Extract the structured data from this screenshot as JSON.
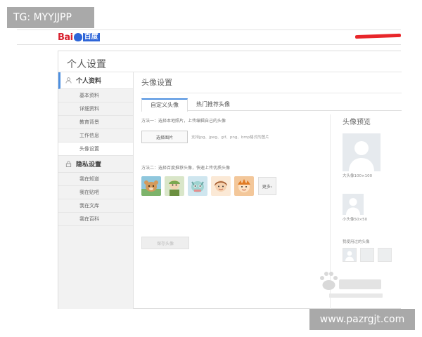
{
  "overlay": {
    "tg_label": "TG: MYYJJPP",
    "site_label": "www.pazrgjt.com"
  },
  "header": {
    "logo_left": "Bai",
    "logo_right": "百度"
  },
  "page": {
    "title": "个人设置"
  },
  "sidebar": {
    "section1": "个人资料",
    "items1": [
      "基本资料",
      "详细资料",
      "教育背景",
      "工作信息",
      "头像设置"
    ],
    "section2": "隐私设置",
    "items2": [
      "我在知道",
      "我在贴吧",
      "我在文库",
      "我在百科"
    ]
  },
  "main": {
    "section_title": "头像设置",
    "tabs": [
      "自定义头像",
      "热门推荐头像"
    ],
    "method1": "方法一：选择本地照片，上传编辑自己的头像",
    "select_photo_button": "选择图片",
    "format_hint": "支持jpg、jpeg、gif、png、bmp格式的图片",
    "method2": "方法二：选择百度推荐头像，快速上传优质头像",
    "more_button": "更多›",
    "save_button": "保存头像"
  },
  "preview": {
    "title": "头像预览",
    "big_caption": "大头像100×100",
    "small_caption": "小头像50×50",
    "used_title": "我使用过的头像"
  },
  "colors": {
    "accent": "#4d8fe0",
    "brand_red": "#d8212f",
    "brand_blue": "#2e65d8"
  }
}
